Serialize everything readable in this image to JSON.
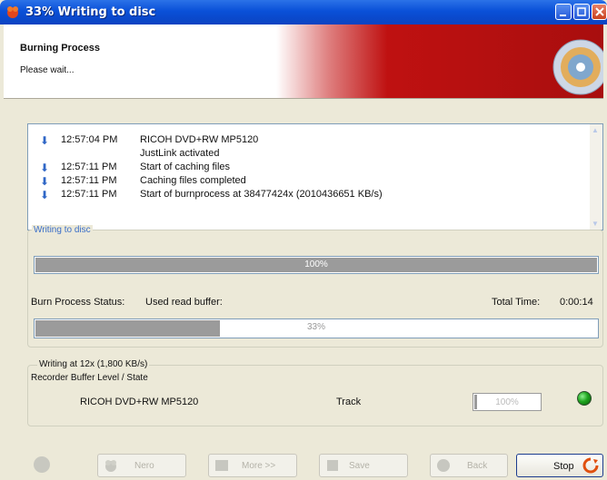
{
  "window": {
    "title": "33% Writing to disc"
  },
  "header": {
    "title": "Burning Process",
    "subtitle": "Please wait..."
  },
  "log": {
    "entries": [
      {
        "time": "12:57:04 PM",
        "message": "RICOH DVD+RW MP5120",
        "icon": "info-icon"
      },
      {
        "time": "",
        "message": "JustLink activated",
        "icon": ""
      },
      {
        "time": "12:57:11 PM",
        "message": "Start of caching files",
        "icon": "info-icon"
      },
      {
        "time": "12:57:11 PM",
        "message": "Caching files completed",
        "icon": "info-icon"
      },
      {
        "time": "12:57:11 PM",
        "message": "Start of burnprocess at 38477424x (2010436651 KB/s)",
        "icon": "info-icon"
      }
    ]
  },
  "writing": {
    "group_label": "Writing to disc",
    "progress1_label": "100%",
    "progress1_value": 1.0,
    "status_label": "Burn Process Status:",
    "status_value": "Used read buffer:",
    "total_time_label": "Total Time:",
    "total_time_value": "0:00:14",
    "progress2_label": "33%",
    "progress2_value": 0.33
  },
  "recorder": {
    "group_label": "Writing at 12x (1,800 KB/s)",
    "buffer_label": "Recorder Buffer Level / State",
    "device": "RICOH DVD+RW MP5120",
    "track_label": "Track",
    "track_value": "100%",
    "led_color": "#1fa51f"
  },
  "buttons": {
    "nero": "Nero",
    "more": "More >>",
    "save": "Save",
    "back": "Back",
    "stop": "Stop"
  },
  "colors": {
    "titlebar": "#0a50d8",
    "banner_red": "#bf1111",
    "panel": "#ece9d8"
  }
}
